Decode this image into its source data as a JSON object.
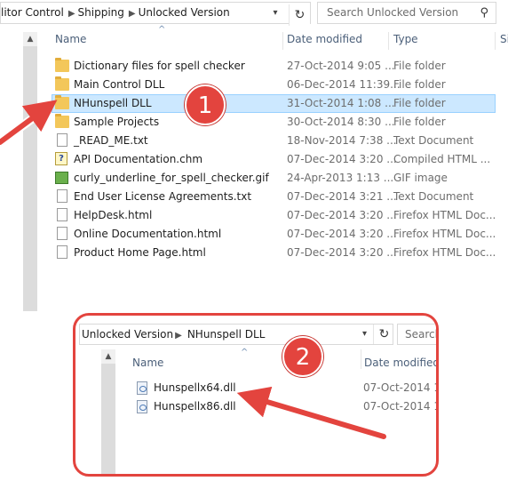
{
  "window1": {
    "breadcrumbs": [
      "litor Control",
      "Shipping",
      "Unlocked Version"
    ],
    "refresh_icon": "refresh-icon",
    "search_placeholder": "Search Unlocked Version",
    "columns": {
      "name": "Name",
      "date": "Date modified",
      "type": "Type",
      "size": "Si"
    },
    "items": [
      {
        "name": "Dictionary files for spell checker",
        "date": "27-Oct-2014 9:05 ...",
        "type": "File folder",
        "icon": "folder-icon"
      },
      {
        "name": "Main Control DLL",
        "date": "06-Dec-2014 11:39...",
        "type": "File folder",
        "icon": "folder-icon"
      },
      {
        "name": "NHunspell DLL",
        "date": "31-Oct-2014 1:08 ...",
        "type": "File folder",
        "icon": "folder-icon",
        "selected": true
      },
      {
        "name": "Sample Projects",
        "date": "30-Oct-2014 8:30 ...",
        "type": "File folder",
        "icon": "folder-icon"
      },
      {
        "name": "_READ_ME.txt",
        "date": "18-Nov-2014 7:38 ...",
        "type": "Text Document",
        "icon": "text-file-icon"
      },
      {
        "name": "API Documentation.chm",
        "date": "07-Dec-2014 3:20 ...",
        "type": "Compiled HTML ...",
        "icon": "help-file-icon"
      },
      {
        "name": "curly_underline_for_spell_checker.gif",
        "date": "24-Apr-2013 1:13 ...",
        "type": "GIF image",
        "icon": "image-file-icon"
      },
      {
        "name": "End User License Agreements.txt",
        "date": "07-Dec-2014 3:21 ...",
        "type": "Text Document",
        "icon": "text-file-icon"
      },
      {
        "name": "HelpDesk.html",
        "date": "07-Dec-2014 3:20 ...",
        "type": "Firefox HTML Doc...",
        "icon": "html-file-icon"
      },
      {
        "name": "Online Documentation.html",
        "date": "07-Dec-2014 3:20 ...",
        "type": "Firefox HTML Doc...",
        "icon": "html-file-icon"
      },
      {
        "name": "Product Home Page.html",
        "date": "07-Dec-2014 3:20 ...",
        "type": "Firefox HTML Doc...",
        "icon": "html-file-icon"
      }
    ]
  },
  "callouts": {
    "one": "1",
    "two": "2",
    "color": "#e3443e"
  },
  "window2": {
    "breadcrumbs": [
      "Unlocked Version",
      "NHunspell DLL"
    ],
    "search_placeholder": "Search",
    "columns": {
      "name": "Name",
      "date": "Date modified"
    },
    "items": [
      {
        "name": "Hunspellx64.dll",
        "date": "07-Oct-2014 1:",
        "icon": "dll-file-icon"
      },
      {
        "name": "Hunspellx86.dll",
        "date": "07-Oct-2014 1:",
        "icon": "dll-file-icon"
      }
    ]
  }
}
